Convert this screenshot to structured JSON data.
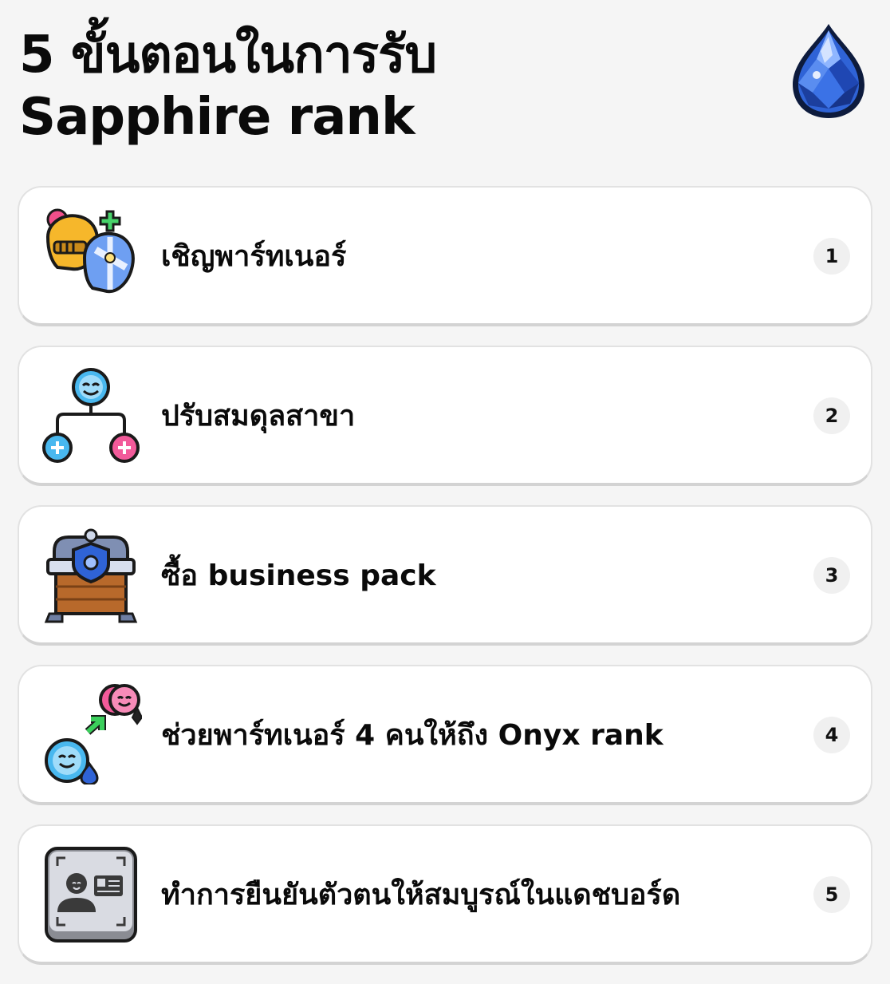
{
  "header": {
    "title_line1": "5 ขั้นตอนในการรับ",
    "title_line2": "Sapphire rank",
    "icon": "sapphire-gem-icon"
  },
  "steps": [
    {
      "number": "1",
      "label": "เชิญพาร์ทเนอร์",
      "icon": "knight-helmets-icon"
    },
    {
      "number": "2",
      "label": "ปรับสมดุลสาขา",
      "icon": "team-branches-icon"
    },
    {
      "number": "3",
      "label": "ซื้อ business pack",
      "icon": "treasure-chest-icon"
    },
    {
      "number": "4",
      "label": "ช่วยพาร์ทเนอร์ 4 คนให้ถึง Onyx rank",
      "icon": "partner-upgrade-icon"
    },
    {
      "number": "5",
      "label": "ทำการยืนยันตัวตนให้สมบูรณ์ในแดชบอร์ด",
      "icon": "id-verification-icon"
    }
  ],
  "colors": {
    "background": "#f5f5f5",
    "card": "#ffffff",
    "card_border": "#d3d3d3",
    "number_badge": "#f0f0f0",
    "sapphire_blue": "#2f63d6",
    "bubble_blue": "#49b8ef",
    "bubble_pink": "#f25a9a"
  }
}
